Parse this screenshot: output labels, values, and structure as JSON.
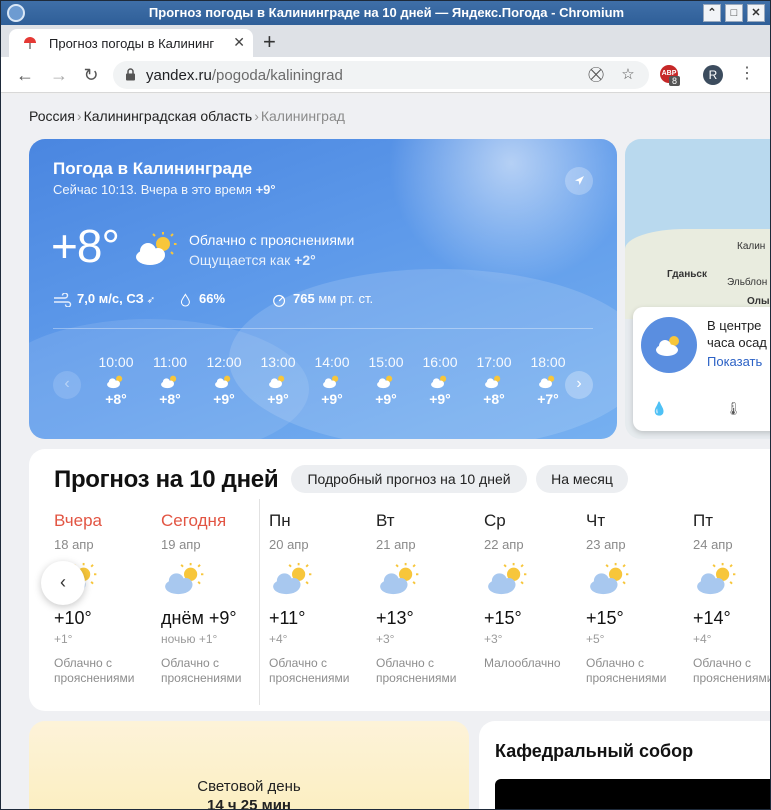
{
  "window": {
    "title": "Прогноз погоды в Калининграде на 10 дней — Яндекс.Погода - Chromium",
    "controls": [
      "⌃",
      "□",
      "✕"
    ]
  },
  "tabs": [
    {
      "label": "Прогноз погоды в Калининг",
      "close": "✕"
    }
  ],
  "new_tab_label": "+",
  "toolbar": {
    "back": "←",
    "forward": "→",
    "reload": "↻",
    "url_host": "yandex.ru",
    "url_path": "/pogoda/kaliningrad",
    "extension_badge": "8",
    "extension_label": "ABP",
    "profile_initial": "R",
    "menu": "⋮"
  },
  "breadcrumbs": {
    "items": [
      "Россия",
      "Калининградская область",
      "Калининград"
    ],
    "separator": "›"
  },
  "current": {
    "title": "Погода в Калининграде",
    "now_prefix": "Сейчас 10:13. Вчера в это время",
    "yesterday_temp": "+9°",
    "temp": "+8°",
    "condition": "Облачно с прояснениями",
    "feels_prefix": "Ощущается как",
    "feels_temp": "+2°",
    "wind": "7,0 м/с, СЗ",
    "humidity": "66%",
    "pressure_value": "765",
    "pressure_unit": "мм рт. ст.",
    "prev_label": "‹",
    "next_label": "›"
  },
  "hourly": [
    {
      "time": "10:00",
      "temp": "+8°"
    },
    {
      "time": "11:00",
      "temp": "+8°"
    },
    {
      "time": "12:00",
      "temp": "+9°"
    },
    {
      "time": "13:00",
      "temp": "+9°"
    },
    {
      "time": "14:00",
      "temp": "+9°"
    },
    {
      "time": "15:00",
      "temp": "+9°"
    },
    {
      "time": "16:00",
      "temp": "+9°"
    },
    {
      "time": "17:00",
      "temp": "+8°"
    },
    {
      "time": "18:00",
      "temp": "+7°"
    }
  ],
  "map": {
    "labels": [
      "Калин",
      "Гданьск",
      "Эльблон",
      "Олы"
    ],
    "popup_line1": "В центре",
    "popup_line2": "часа осад",
    "popup_link": "Показать"
  },
  "forecast": {
    "title": "Прогноз на 10 дней",
    "detail_button": "Подробный прогноз на 10 дней",
    "month_button": "На месяц",
    "prev_label": "‹",
    "days": [
      {
        "name": "Вчера",
        "date": "18 апр",
        "temp": "+10°",
        "night": "+1°",
        "cond1": "Облачно с",
        "cond2": "прояснениями",
        "highlight": true
      },
      {
        "name": "Сегодня",
        "date": "19 апр",
        "temp": "днём +9°",
        "night": "ночью +1°",
        "cond1": "Облачно с",
        "cond2": "прояснениями",
        "highlight": true
      },
      {
        "name": "Пн",
        "date": "20 апр",
        "temp": "+11°",
        "night": "+4°",
        "cond1": "Облачно с",
        "cond2": "прояснениями",
        "highlight": false
      },
      {
        "name": "Вт",
        "date": "21 апр",
        "temp": "+13°",
        "night": "+3°",
        "cond1": "Облачно с",
        "cond2": "прояснениями",
        "highlight": false
      },
      {
        "name": "Ср",
        "date": "22 апр",
        "temp": "+15°",
        "night": "+3°",
        "cond1": "Малооблачно",
        "cond2": "",
        "highlight": false
      },
      {
        "name": "Чт",
        "date": "23 апр",
        "temp": "+15°",
        "night": "+5°",
        "cond1": "Облачно с",
        "cond2": "прояснениями",
        "highlight": false
      },
      {
        "name": "Пт",
        "date": "24 апр",
        "temp": "+14°",
        "night": "+4°",
        "cond1": "Облачно с",
        "cond2": "прояснениями",
        "highlight": false
      }
    ]
  },
  "daylight": {
    "label": "Световой день",
    "value": "14 ч 25 мин"
  },
  "cathedral": {
    "title": "Кафедральный собор"
  },
  "colors": {
    "accent_red": "#e25543",
    "hero_blue": "#4a86e0",
    "link_blue": "#2c62c6",
    "sun_yellow": "#f7c63b"
  },
  "icons": {
    "weather": "partly-cloudy-icon",
    "wind": "wind-icon",
    "humidity": "drop-icon",
    "pressure": "gauge-icon",
    "locate": "locate-arrow-icon"
  }
}
